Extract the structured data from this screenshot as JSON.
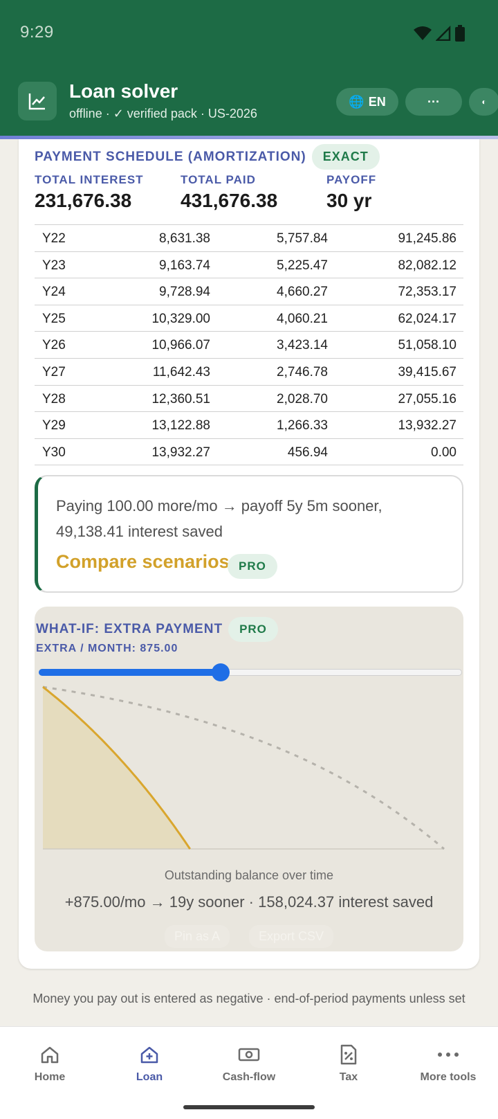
{
  "status_bar": {
    "time": "9:29"
  },
  "app_bar": {
    "title": "Loan solver",
    "subtitle": "offline · ✓ verified pack · US-2026",
    "language_label": "EN",
    "more_label": "···",
    "theme_label": "◐"
  },
  "schedule": {
    "title": "PAYMENT SCHEDULE (AMORTIZATION)",
    "badge": "EXACT",
    "stats": [
      {
        "label": "TOTAL INTEREST",
        "value": "231,676.38"
      },
      {
        "label": "TOTAL PAID",
        "value": "431,676.38"
      },
      {
        "label": "PAYOFF",
        "value": "30 yr"
      }
    ],
    "rows": [
      [
        "Y22",
        "8,631.38",
        "5,757.84",
        "91,245.86"
      ],
      [
        "Y23",
        "9,163.74",
        "5,225.47",
        "82,082.12"
      ],
      [
        "Y24",
        "9,728.94",
        "4,660.27",
        "72,353.17"
      ],
      [
        "Y25",
        "10,329.00",
        "4,060.21",
        "62,024.17"
      ],
      [
        "Y26",
        "10,966.07",
        "3,423.14",
        "51,058.10"
      ],
      [
        "Y27",
        "11,642.43",
        "2,746.78",
        "39,415.67"
      ],
      [
        "Y28",
        "12,360.51",
        "2,028.70",
        "27,055.16"
      ],
      [
        "Y29",
        "13,122.88",
        "1,266.33",
        "13,932.27"
      ],
      [
        "Y30",
        "13,932.27",
        "456.94",
        "0.00"
      ]
    ]
  },
  "tip": {
    "text": "Paying 100.00 more/mo → payoff 5y 5m sooner, 49,138.41 interest saved",
    "link": "Compare scenarios",
    "badge": "PRO"
  },
  "what_if": {
    "title": "WHAT-IF: EXTRA PAYMENT",
    "badge": "PRO",
    "extra_label": "EXTRA / MONTH: 875.00",
    "slider_fraction": 0.43,
    "caption": "Outstanding balance over time",
    "result": "+875.00/mo → 19y sooner · 158,024.37 interest saved",
    "pin_label": "Pin as A",
    "export_label": "Export CSV",
    "colors": {
      "extra_line": "#d9a62e",
      "extra_fill": "#e5dcbe",
      "baseline_line": "#b5b2ab",
      "slider": "#1f6ee6"
    }
  },
  "footnote": "Money you pay out is entered as negative · end-of-period payments unless set",
  "bottom_nav": [
    {
      "label": "Home",
      "icon": "home-icon",
      "active": false
    },
    {
      "label": "Loan",
      "icon": "loan-icon",
      "active": true
    },
    {
      "label": "Cash-flow",
      "icon": "cash-icon",
      "active": false
    },
    {
      "label": "Tax",
      "icon": "tax-icon",
      "active": false
    },
    {
      "label": "More tools",
      "icon": "more-icon",
      "active": false
    }
  ]
}
